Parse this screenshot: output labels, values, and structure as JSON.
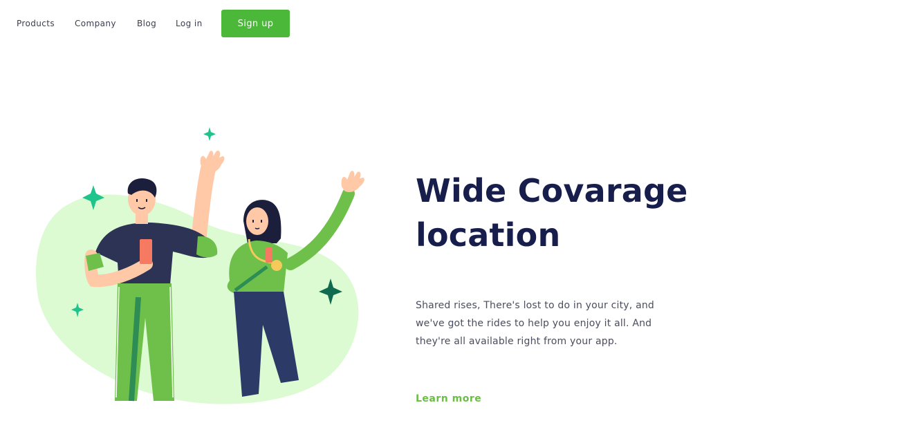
{
  "nav": {
    "links": [
      {
        "label": "Products"
      },
      {
        "label": "Company"
      },
      {
        "label": "Blog"
      },
      {
        "label": "Log in"
      }
    ],
    "signup_label": "Sign up"
  },
  "hero": {
    "title_line1": "Wide Covarage",
    "title_line2": "location",
    "description": "Shared rises, There's lost to do in your city, and we've got the rides to help you enjoy it all. And they're all available right from your app.",
    "cta_label": "Learn more"
  },
  "colors": {
    "accent": "#4cb83a",
    "heading": "#181e4b",
    "blob": "#dcfbd2",
    "sparkle": "#1fc48c",
    "sparkle_dark": "#0f6a4f"
  }
}
